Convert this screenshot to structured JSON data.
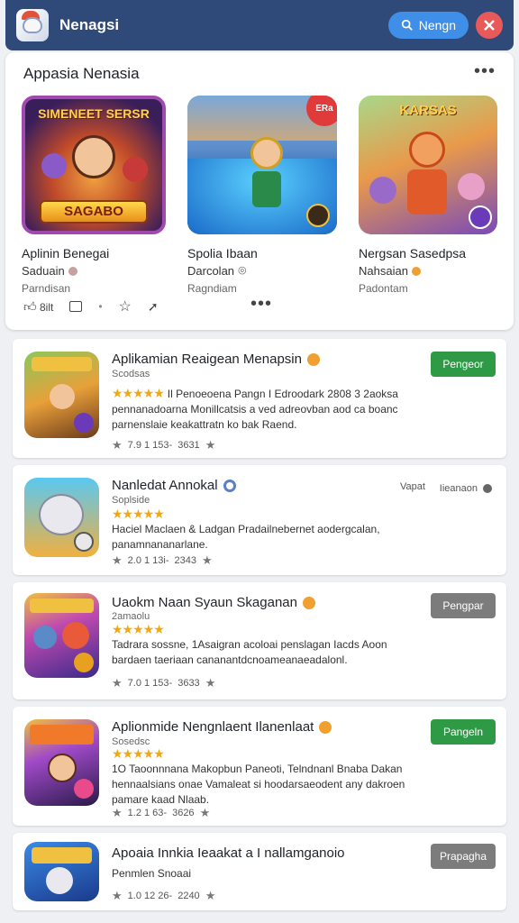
{
  "header": {
    "title": "Nenagsi",
    "search_label": "Nengn",
    "accent": "#2f4a78",
    "search_color": "#3f8ee8",
    "close_color": "#e85a5a"
  },
  "featured": {
    "title": "Appasia Nenasia",
    "more_icon": "more-horizontal-icon",
    "items": [
      {
        "name": "Aplinin Benegai",
        "sub": "Saduain",
        "category": "Parndisan",
        "banner_text": "SAGABO",
        "top_text": "SIMENEET SERSR"
      },
      {
        "name": "Spolia Ibaan",
        "sub": "Darcolan",
        "category": "Ragndiam",
        "badge": "ERa"
      },
      {
        "name": "Nergsan Sasedpsa",
        "sub": "Nahsaian",
        "category": "Padontam",
        "top_text": "KARSAS"
      }
    ],
    "actions": {
      "likes": "8ilt"
    }
  },
  "apps": [
    {
      "name": "Aplikamian Reaigean Menapsin",
      "publisher": "Scodsas",
      "stars": "★★★★★",
      "desc": "Il Penoeoena Pangn I Edroodark 2808 3 2aoksa pennanadoarna Monillcatsis a ved adreovban aod ca boanc parnenslaie keakattratn ko bak Raend.",
      "rating": "7.9 1 153-",
      "downloads": "3631",
      "button": "Pengeor",
      "button_style": "green",
      "verif_color": "#f0a030"
    },
    {
      "name": "Nanledat Annokal",
      "publisher": "Soplside",
      "stars": "★★★★★",
      "desc": "Haciel Maclaen & Ladgan Pradailnebernet aodergcalan, panamnananarlane.",
      "rating": "2.0 1 13i-",
      "downloads": "2343",
      "button": "Iieanaon",
      "button_label2": "Vapat",
      "button_style": "ghost",
      "verif_color": "#5b7fc8"
    },
    {
      "name": "Uaokm Naan Syaun Skaganan",
      "publisher": "2amaolu",
      "stars": "★★★★★",
      "desc": "Tadrara sossne, 1Asaigran acoloai penslagan Iacds Aoon bardaen taeriaan cananantdcnoameanaeadalonl.",
      "rating": "7.0 1 153-",
      "downloads": "3633",
      "button": "Pengpar",
      "button_style": "gray",
      "verif_color": "#f0a030"
    },
    {
      "name": "Aplionmide Nengnlaent Ilanenlaat",
      "publisher": "Sosedsc",
      "stars": "★★★★★",
      "desc": "1O Taoonnnana Makopbun Paneoti, Telndnanl Bnaba Dakan hennaalsians onae Vamaleat si hoodarsaeodent any dakroen pamare kaad Nlaab.",
      "rating": "1.2 1 63-",
      "downloads": "3626",
      "button": "Pangeln",
      "button_style": "green",
      "verif_color": "#f0a030"
    },
    {
      "name": "Apoaia Innkia Ieaakat a I nallamganoio",
      "publisher": "Penmlen Snoaai",
      "stars": "",
      "desc": "",
      "rating": "1.0 12 26-",
      "downloads": "2240",
      "button": "Prapagha",
      "button_style": "gray",
      "verif_color": ""
    }
  ]
}
